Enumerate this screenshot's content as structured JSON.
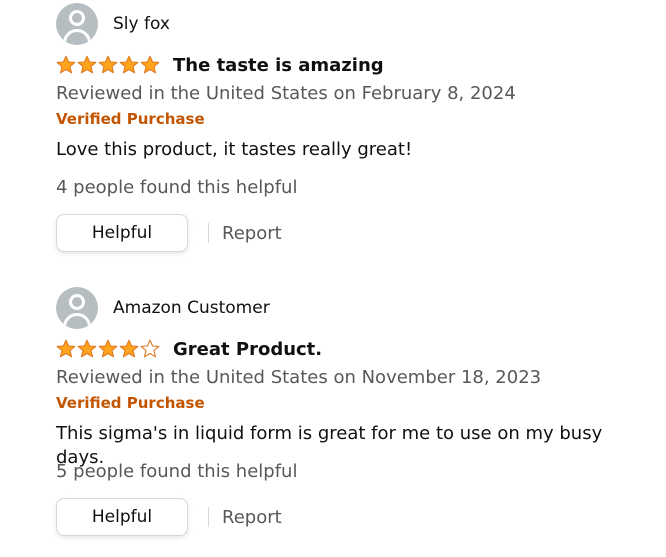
{
  "reviews": [
    {
      "profile_name": "Sly fox",
      "rating": 5,
      "rating_max": 5,
      "title": "The taste is amazing",
      "date_line": "Reviewed in the United States on February 8, 2024",
      "verified_label": "Verified Purchase",
      "body": "Love this product, it tastes really great!",
      "helpful_count_text": "4 people found this helpful",
      "helpful_button_label": "Helpful",
      "report_label": "Report"
    },
    {
      "profile_name": "Amazon Customer",
      "rating": 4,
      "rating_max": 5,
      "title": "Great Product.",
      "date_line": "Reviewed in the United States on November 18, 2023",
      "verified_label": "Verified Purchase",
      "body": "This sigma's in liquid form is great for me to use on my busy days.",
      "helpful_count_text": "5 people found this helpful",
      "helpful_button_label": "Helpful",
      "report_label": "Report"
    }
  ],
  "icons": {
    "avatar": "user-silhouette-icon",
    "star_filled": "star-filled-icon",
    "star_empty": "star-outline-icon"
  },
  "colors": {
    "star": "#ffa41c",
    "star_stroke": "#de7921",
    "verified": "#c45500",
    "secondary_text": "#565959",
    "primary_text": "#0f1111"
  }
}
